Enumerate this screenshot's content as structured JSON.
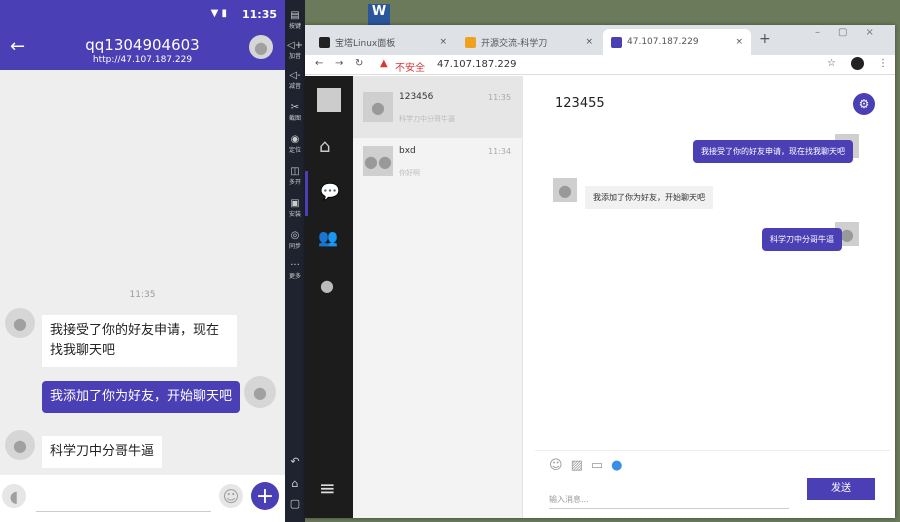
{
  "phone": {
    "status_time": "11:35",
    "title": "qq1304904603",
    "subtitle": "http://47.107.187.229",
    "timestamp": "11:35",
    "messages": [
      {
        "side": "left",
        "text": "我接受了你的好友申请，现在找我聊天吧"
      },
      {
        "side": "right",
        "text": "我添加了你为好友，开始聊天吧"
      },
      {
        "side": "left",
        "text": "科学刀中分哥牛逼"
      }
    ]
  },
  "emulator_toolbar": [
    "按键",
    "加音",
    "减音",
    "截图",
    "定位",
    "多开",
    "安装",
    "同步",
    "更多"
  ],
  "browser": {
    "tabs": [
      {
        "label": "宝塔Linux面板",
        "color": "#222222"
      },
      {
        "label": "开源交流-科学刀",
        "color": "#f0a020"
      },
      {
        "label": "47.107.187.229",
        "color": "#4a3fb5"
      }
    ],
    "insecure_label": "不安全",
    "url": "47.107.187.229"
  },
  "web_chat": {
    "contacts": [
      {
        "name": "123456",
        "time": "11:35",
        "preview": "科学刀中分哥牛逼"
      },
      {
        "name": "bxd",
        "time": "11:34",
        "preview": "你好啊"
      }
    ],
    "title": "123455",
    "messages": [
      {
        "side": "right",
        "text": "我接受了你的好友申请，现在找我聊天吧"
      },
      {
        "side": "left",
        "text": "我添加了你为好友，开始聊天吧"
      },
      {
        "side": "right",
        "text": "科学刀中分哥牛逼"
      }
    ],
    "input_placeholder": "输入消息...",
    "send_label": "发送"
  },
  "colors": {
    "accent": "#4a3fb5"
  }
}
